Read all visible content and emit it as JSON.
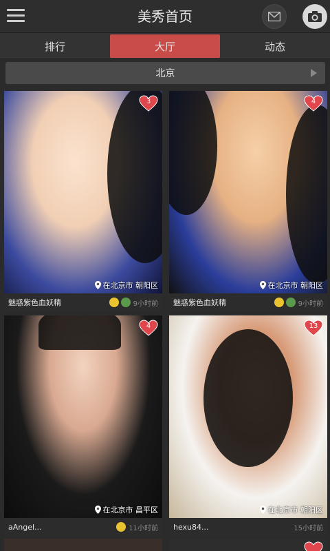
{
  "header": {
    "title": "美秀首页",
    "menu_icon": "menu-icon",
    "mail_icon": "mail-icon",
    "camera_icon": "camera-icon"
  },
  "tabs": [
    {
      "label": "排行",
      "active": false
    },
    {
      "label": "大厅",
      "active": true
    },
    {
      "label": "动态",
      "active": false
    }
  ],
  "city": {
    "label": "北京"
  },
  "colors": {
    "accent": "#c94c49",
    "heart": "#e0474c",
    "background": "#2b2b2b"
  },
  "cards": [
    {
      "likes": "3",
      "location": "在北京市 朝阳区",
      "name": "魅惑紫色血妖精",
      "time": "9小时前",
      "badges": [
        "gold",
        "mail"
      ]
    },
    {
      "likes": "4",
      "location": "在北京市 朝阳区",
      "name": "魅惑紫色血妖精",
      "time": "9小时前",
      "badges": [
        "gold",
        "mail"
      ]
    },
    {
      "likes": "4",
      "location": "在北京市 昌平区",
      "name": "aAngel...",
      "time": "11小时前",
      "badges": [
        "gold"
      ]
    },
    {
      "likes": "13",
      "location": "在北京市 朝阳区",
      "name": "hexu84...",
      "time": "15小时前",
      "badges": []
    }
  ]
}
